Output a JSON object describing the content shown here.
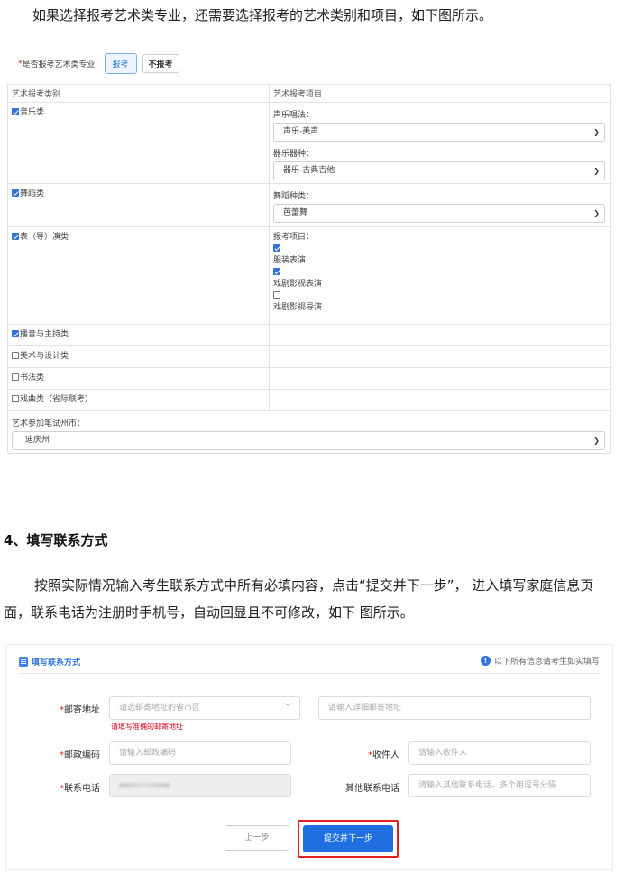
{
  "intro_paragraph": "如果选择报考艺术类专业，还需要选择报考的艺术类别和项目，如下图所示。",
  "art_form": {
    "question_label": "是否报考艺术类专业",
    "required_mark": "*",
    "option_apply": "报考",
    "option_not_apply": "不报考",
    "col_category": "艺术报考类别",
    "col_project": "艺术报考项目",
    "rows": [
      {
        "category": "音乐类",
        "checked": true
      },
      {
        "category": "舞蹈类",
        "checked": true
      },
      {
        "category": "表（导）演类",
        "checked": true
      },
      {
        "category": "播音与主持类",
        "checked": true
      },
      {
        "category": "美术与设计类",
        "checked": false
      },
      {
        "category": "书法类",
        "checked": false
      },
      {
        "category": "戏曲类（省际联考）",
        "checked": false
      }
    ],
    "music": {
      "vocal_label": "声乐唱法：",
      "vocal_value": "声乐-美声",
      "instrument_label": "器乐器种：",
      "instrument_value": "器乐-古典吉他"
    },
    "dance": {
      "type_label": "舞蹈种类：",
      "type_value": "芭蕾舞"
    },
    "acting": {
      "items_label": "报考项目：",
      "items": [
        {
          "label": "服装表演",
          "checked": true
        },
        {
          "label": "戏剧影视表演",
          "checked": true
        },
        {
          "label": "戏剧影视导演",
          "checked": false
        }
      ]
    },
    "exam_city_label": "艺术参加笔试州市：",
    "exam_city_value": "迪庆州",
    "chevron": "chevron-down-icon"
  },
  "section_title": "4、填写联系方式",
  "contact_paragraph": "按照实际情况输入考生联系方式中所有必填内容，点击“提交并下一步”， 进入填写家庭信息页面，联系电话为注册时手机号，自动回显且不可修改，如下 图所示。",
  "contact_form": {
    "title": "填写联系方式",
    "note": "以下所有信息请考生如实填写",
    "mail_address_label": "邮寄地址",
    "region_placeholder": "请选邮寄地址的省市区",
    "detail_placeholder": "请输入详细邮寄地址",
    "address_error": "请填写准确的邮寄地址",
    "postcode_label": "邮政编码",
    "postcode_placeholder": "请输入邮政编码",
    "recipient_label": "收件人",
    "recipient_placeholder": "请输入收件人",
    "phone_label": "联系电话",
    "other_phone_label": "其他联系电话",
    "other_phone_placeholder": "请输入其他联系电话，多个用逗号分隔",
    "prev_button": "上一步",
    "next_button": "提交并下一步",
    "highlight_color": "#e02020",
    "accent_color": "#1f6fe0"
  }
}
